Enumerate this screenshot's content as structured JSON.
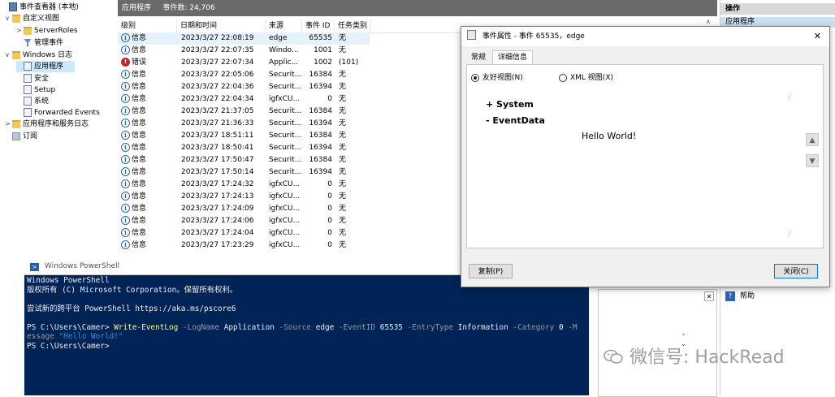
{
  "tree": {
    "items": [
      {
        "label": "事件查看器 (本地)",
        "icon": "event-viewer-icon",
        "chevron": ""
      },
      {
        "label": "自定义视图",
        "icon": "folder-icon",
        "chevron": "∨"
      },
      {
        "label": "ServerRoles",
        "icon": "folder-icon",
        "chevron": ">"
      },
      {
        "label": "管理事件",
        "icon": "filter-icon",
        "chevron": ""
      },
      {
        "label": "Windows 日志",
        "icon": "folder-icon",
        "chevron": "∨"
      },
      {
        "label": "应用程序",
        "icon": "log-icon",
        "chevron": ""
      },
      {
        "label": "安全",
        "icon": "log-icon",
        "chevron": ""
      },
      {
        "label": "Setup",
        "icon": "log-icon",
        "chevron": ""
      },
      {
        "label": "系统",
        "icon": "log-icon",
        "chevron": ""
      },
      {
        "label": "Forwarded Events",
        "icon": "log-icon",
        "chevron": ""
      },
      {
        "label": "应用程序和服务日志",
        "icon": "folder-icon",
        "chevron": ">"
      },
      {
        "label": "订阅",
        "icon": "subscription-icon",
        "chevron": ""
      }
    ]
  },
  "list": {
    "header_title": "应用程序",
    "header_count": "事件数: 24,706",
    "columns": [
      "级别",
      "日期和时间",
      "来源",
      "事件 ID",
      "任务类别"
    ],
    "rows": [
      {
        "level": "信息",
        "type": "info",
        "datetime": "2023/3/27 22:08:19",
        "source": "edge",
        "id": "65535",
        "task": "无"
      },
      {
        "level": "信息",
        "type": "info",
        "datetime": "2023/3/27 22:07:35",
        "source": "Windo...",
        "id": "1001",
        "task": "无"
      },
      {
        "level": "错误",
        "type": "error",
        "datetime": "2023/3/27 22:07:34",
        "source": "Applic...",
        "id": "1002",
        "task": "(101)"
      },
      {
        "level": "信息",
        "type": "info",
        "datetime": "2023/3/27 22:05:06",
        "source": "Securit...",
        "id": "16384",
        "task": "无"
      },
      {
        "level": "信息",
        "type": "info",
        "datetime": "2023/3/27 22:04:36",
        "source": "Securit...",
        "id": "16394",
        "task": "无"
      },
      {
        "level": "信息",
        "type": "info",
        "datetime": "2023/3/27 22:04:34",
        "source": "igfxCU...",
        "id": "0",
        "task": "无"
      },
      {
        "level": "信息",
        "type": "info",
        "datetime": "2023/3/27 21:37:05",
        "source": "Securit...",
        "id": "16384",
        "task": "无"
      },
      {
        "level": "信息",
        "type": "info",
        "datetime": "2023/3/27 21:36:33",
        "source": "Securit...",
        "id": "16394",
        "task": "无"
      },
      {
        "level": "信息",
        "type": "info",
        "datetime": "2023/3/27 18:51:11",
        "source": "Securit...",
        "id": "16384",
        "task": "无"
      },
      {
        "level": "信息",
        "type": "info",
        "datetime": "2023/3/27 18:50:41",
        "source": "Securit...",
        "id": "16394",
        "task": "无"
      },
      {
        "level": "信息",
        "type": "info",
        "datetime": "2023/3/27 17:50:47",
        "source": "Securit...",
        "id": "16384",
        "task": "无"
      },
      {
        "level": "信息",
        "type": "info",
        "datetime": "2023/3/27 17:50:14",
        "source": "Securit...",
        "id": "16394",
        "task": "无"
      },
      {
        "level": "信息",
        "type": "info",
        "datetime": "2023/3/27 17:24:32",
        "source": "igfxCU...",
        "id": "0",
        "task": "无"
      },
      {
        "level": "信息",
        "type": "info",
        "datetime": "2023/3/27 17:24:13",
        "source": "igfxCU...",
        "id": "0",
        "task": "无"
      },
      {
        "level": "信息",
        "type": "info",
        "datetime": "2023/3/27 17:24:09",
        "source": "igfxCU...",
        "id": "0",
        "task": "无"
      },
      {
        "level": "信息",
        "type": "info",
        "datetime": "2023/3/27 17:24:06",
        "source": "igfxCU...",
        "id": "0",
        "task": "无"
      },
      {
        "level": "信息",
        "type": "info",
        "datetime": "2023/3/27 17:24:04",
        "source": "igfxCU...",
        "id": "0",
        "task": "无"
      },
      {
        "level": "信息",
        "type": "info",
        "datetime": "2023/3/27 17:23:29",
        "source": "igfxCU...",
        "id": "0",
        "task": "无"
      }
    ]
  },
  "actions": {
    "title": "操作",
    "section": "应用程序",
    "help": "帮助"
  },
  "dialog": {
    "title": "事件属性 - 事件 65535，edge",
    "close_glyph": "✕",
    "tabs": [
      "常规",
      "详细信息"
    ],
    "view_friendly": "友好视图(N)",
    "view_xml": "XML 视图(X)",
    "system_label": "+  System",
    "eventdata_label": "-  EventData",
    "eventdata_value": "Hello World!",
    "copy_button": "复制(P)",
    "close_button": "关闭(C)"
  },
  "powershell": {
    "title": "Windows PowerShell",
    "lines": [
      "Windows PowerShell",
      "版权所有 (C) Microsoft Corporation。保留所有权利。",
      "",
      "尝试新的跨平台 PowerShell https://aka.ms/pscore6",
      ""
    ],
    "prompt": "PS C:\\Users\\Camer>",
    "cmdlet": "Write-EventLog",
    "args": [
      {
        "param": "-LogName",
        "value": "Application"
      },
      {
        "param": "-Source",
        "value": "edge"
      },
      {
        "param": "-EventID",
        "value": "65535"
      },
      {
        "param": "-EntryType",
        "value": "Information"
      },
      {
        "param": "-Category",
        "value": "0"
      }
    ],
    "wrap_param_start": "-M",
    "wrap_param_end": "essage",
    "message_value": "\"Hello World!\"",
    "final_prompt": "PS C:\\Users\\Camer>"
  },
  "watermark": "微信号: HackRead"
}
